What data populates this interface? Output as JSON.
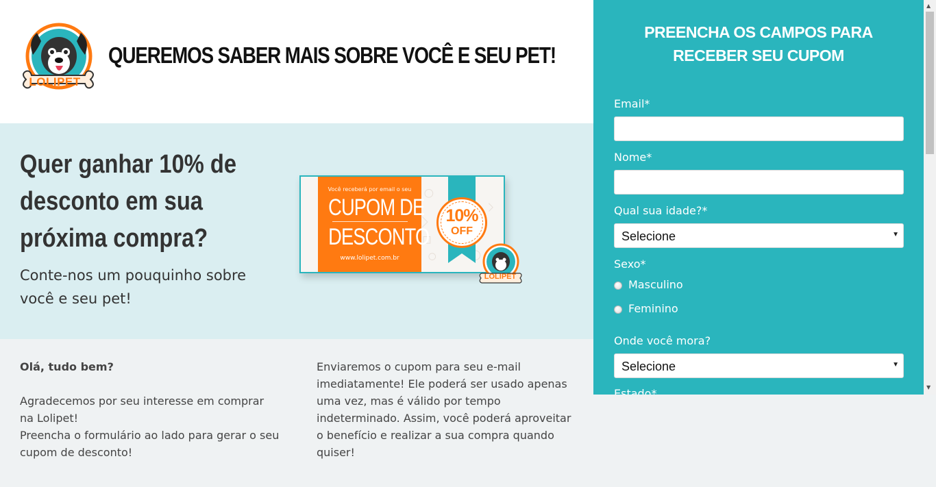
{
  "header": {
    "title": "QUEREMOS SABER MAIS SOBRE VOCÊ E SEU PET!",
    "logo_text": "LOLIPET"
  },
  "hero": {
    "headline": "Quer ganhar 10% de desconto em sua próxima compra?",
    "subtext": "Conte-nos um pouquinho sobre você e seu pet!"
  },
  "coupon": {
    "small_text": "Você receberá por email o seu",
    "line1": "CUPOM DE",
    "line2": "DESCONTO",
    "url": "www.lolipet.com.br",
    "badge_pct": "10%",
    "badge_off": "OFF",
    "logo_text": "LOLIPET"
  },
  "info": {
    "greeting": "Olá, tudo bem?",
    "left_text": "Agradecemos por seu interesse em comprar na Lolipet!\nPreencha o formulário ao lado para gerar o seu cupom de desconto!",
    "right_text": "Enviaremos o cupom para seu e-mail imediatamente! Ele poderá ser usado apenas uma vez, mas é válido por tempo indeterminado. Assim, você poderá aproveitar o benefício e realizar a sua compra quando quiser!"
  },
  "form": {
    "title": "PREENCHA OS CAMPOS PARA RECEBER SEU CUPOM",
    "email_label": "Email*",
    "email_value": "",
    "name_label": "Nome*",
    "name_value": "",
    "age_label": "Qual sua idade?*",
    "age_selected": "Selecione",
    "sex_label": "Sexo*",
    "sex_options": [
      "Masculino",
      "Feminino"
    ],
    "location_label": "Onde você mora?",
    "location_selected": "Selecione",
    "state_label": "Estado*"
  },
  "colors": {
    "teal": "#2ab5bd",
    "orange": "#ff7a11",
    "hero_bg": "#daeef1",
    "page_bg": "#eff2f3"
  },
  "icons": {
    "scroll_up": "scroll-up-arrow-icon",
    "scroll_down": "scroll-down-arrow-icon",
    "select_arrow": "chevron-down-icon"
  }
}
